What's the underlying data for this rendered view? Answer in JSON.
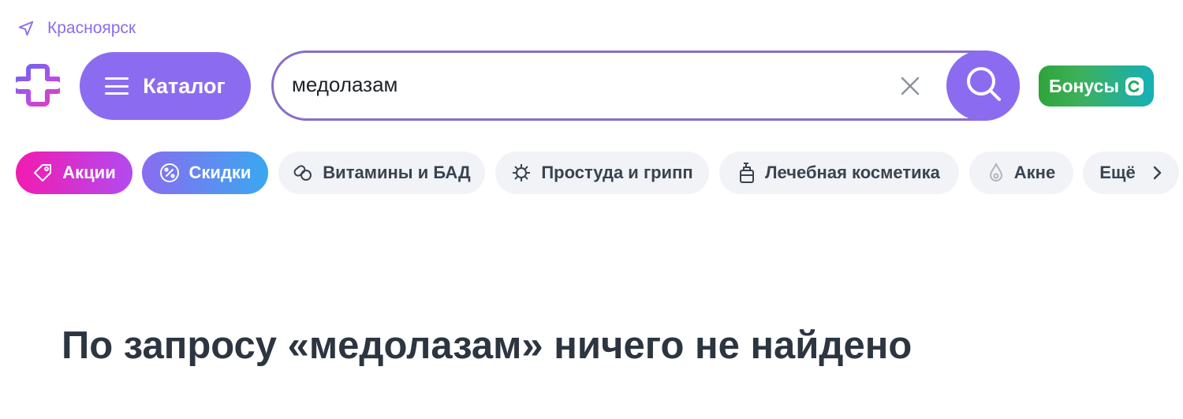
{
  "location": {
    "city": "Красноярск",
    "icon": "location-arrow-icon"
  },
  "header": {
    "logo_icon": "pharmacy-plus-logo-icon",
    "catalog_label": "Каталог",
    "catalog_icon": "menu-icon",
    "bonus_label": "Бонусы",
    "bonus_icon": "bonus-coin-icon"
  },
  "search": {
    "value": "медолазам",
    "placeholder": "",
    "clear_icon": "close-icon",
    "submit_icon": "search-icon"
  },
  "chips": [
    {
      "label": "Акции",
      "icon": "tag-icon"
    },
    {
      "label": "Скидки",
      "icon": "percent-icon"
    },
    {
      "label": "Витамины и БАД",
      "icon": "capsules-icon"
    },
    {
      "label": "Простуда и грипп",
      "icon": "virus-icon"
    },
    {
      "label": "Лечебная косметика",
      "icon": "bottle-icon"
    },
    {
      "label": "Акне",
      "icon": "drop-icon"
    },
    {
      "label": "Ещё",
      "icon": "chevron-right-icon"
    }
  ],
  "results": {
    "empty_message": "По запросу «медолазам» ничего не найдено"
  },
  "colors": {
    "accent": "#8b6cf0",
    "search_border": "#8b6cc8",
    "chip_bg": "#f1f3f7",
    "promo_gradient": [
      "#f21bb0",
      "#b34af0"
    ],
    "discount_gradient": [
      "#8a6cf0",
      "#39a8f0"
    ],
    "bonus_gradient": [
      "#2ea43a",
      "#17b0b8"
    ]
  }
}
